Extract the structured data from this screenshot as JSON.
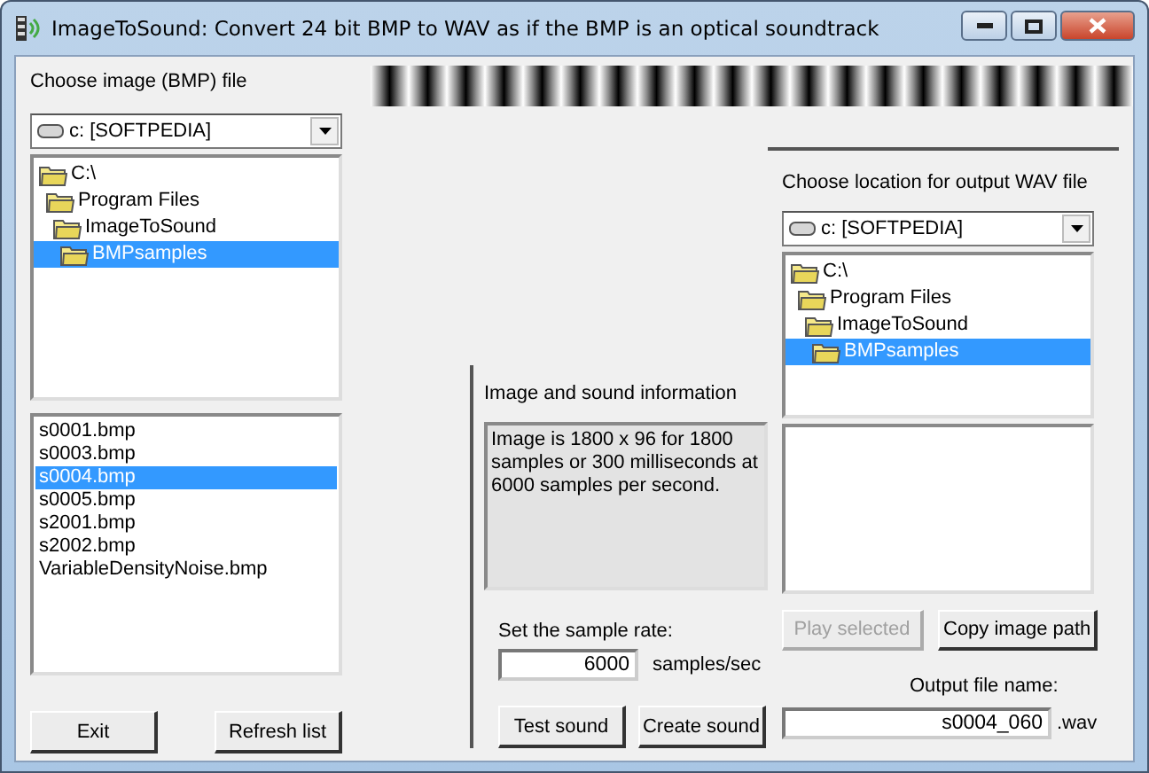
{
  "window": {
    "title": "ImageToSound: Convert 24 bit BMP to WAV as if the BMP is an optical soundtrack"
  },
  "image_panel": {
    "label": "Choose image (BMP) file",
    "drive": "c: [SOFTPEDIA]",
    "folders": [
      {
        "name": "C:\\",
        "selected": false,
        "children": [
          {
            "name": "Program Files",
            "selected": false,
            "children": [
              {
                "name": "ImageToSound",
                "selected": false,
                "children": [
                  {
                    "name": "BMPsamples",
                    "selected": true
                  }
                ]
              }
            ]
          }
        ]
      }
    ],
    "files": [
      {
        "name": "s0001.bmp",
        "selected": false
      },
      {
        "name": "s0003.bmp",
        "selected": false
      },
      {
        "name": "s0004.bmp",
        "selected": true
      },
      {
        "name": "s0005.bmp",
        "selected": false
      },
      {
        "name": "s2001.bmp",
        "selected": false
      },
      {
        "name": "s2002.bmp",
        "selected": false
      },
      {
        "name": "VariableDensityNoise.bmp",
        "selected": false
      }
    ],
    "buttons": [
      {
        "label": "Exit",
        "disabled": false
      },
      {
        "label": "Refresh list",
        "disabled": false
      }
    ]
  },
  "info_panel": {
    "label": "Image and sound information",
    "text": "Image is 1800 x 96 for 1800 samples or 300 milliseconds at 6000 samples per second.",
    "rate_label": "Set the sample rate:",
    "rate": "6000",
    "rate_unit": "samples/sec",
    "buttons": [
      {
        "label": "Test sound",
        "disabled": false
      },
      {
        "label": "Create sound",
        "disabled": false
      }
    ]
  },
  "output_panel": {
    "label": "Choose location for output WAV file",
    "drive": "c: [SOFTPEDIA]",
    "folders": [
      {
        "name": "C:\\",
        "selected": false,
        "children": [
          {
            "name": "Program Files",
            "selected": false,
            "children": [
              {
                "name": "ImageToSound",
                "selected": false,
                "children": [
                  {
                    "name": "BMPsamples",
                    "selected": true
                  }
                ]
              }
            ]
          }
        ]
      }
    ],
    "buttons": [
      {
        "label": "Play selected",
        "disabled": true
      },
      {
        "label": "Copy image path",
        "disabled": false
      }
    ],
    "file_label": "Output file name:",
    "file_name": "s0004_060",
    "extension": ".wav"
  }
}
